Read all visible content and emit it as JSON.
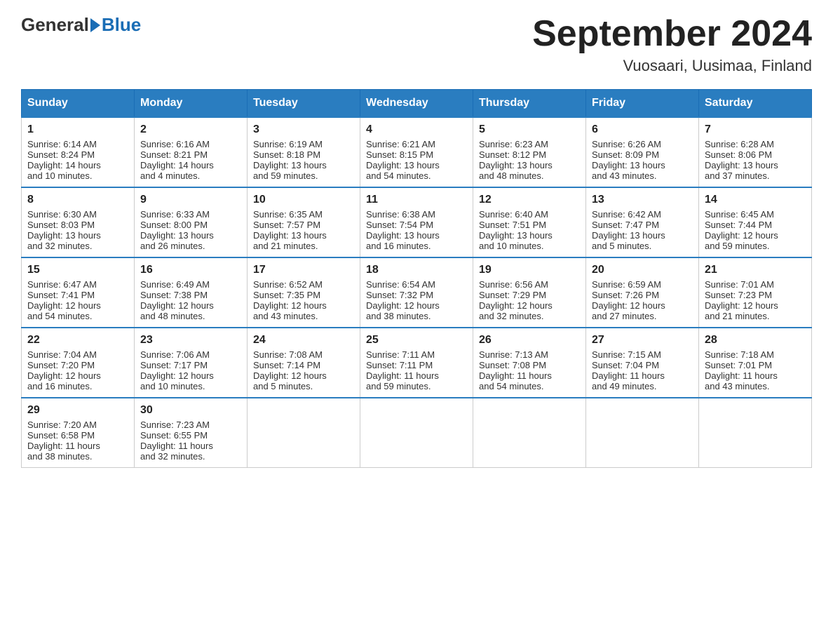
{
  "header": {
    "logo_general": "General",
    "logo_blue": "Blue",
    "month_title": "September 2024",
    "subtitle": "Vuosaari, Uusimaa, Finland"
  },
  "days_of_week": [
    "Sunday",
    "Monday",
    "Tuesday",
    "Wednesday",
    "Thursday",
    "Friday",
    "Saturday"
  ],
  "weeks": [
    [
      {
        "num": "1",
        "sunrise": "6:14 AM",
        "sunset": "8:24 PM",
        "daylight": "14 hours and 10 minutes."
      },
      {
        "num": "2",
        "sunrise": "6:16 AM",
        "sunset": "8:21 PM",
        "daylight": "14 hours and 4 minutes."
      },
      {
        "num": "3",
        "sunrise": "6:19 AM",
        "sunset": "8:18 PM",
        "daylight": "13 hours and 59 minutes."
      },
      {
        "num": "4",
        "sunrise": "6:21 AM",
        "sunset": "8:15 PM",
        "daylight": "13 hours and 54 minutes."
      },
      {
        "num": "5",
        "sunrise": "6:23 AM",
        "sunset": "8:12 PM",
        "daylight": "13 hours and 48 minutes."
      },
      {
        "num": "6",
        "sunrise": "6:26 AM",
        "sunset": "8:09 PM",
        "daylight": "13 hours and 43 minutes."
      },
      {
        "num": "7",
        "sunrise": "6:28 AM",
        "sunset": "8:06 PM",
        "daylight": "13 hours and 37 minutes."
      }
    ],
    [
      {
        "num": "8",
        "sunrise": "6:30 AM",
        "sunset": "8:03 PM",
        "daylight": "13 hours and 32 minutes."
      },
      {
        "num": "9",
        "sunrise": "6:33 AM",
        "sunset": "8:00 PM",
        "daylight": "13 hours and 26 minutes."
      },
      {
        "num": "10",
        "sunrise": "6:35 AM",
        "sunset": "7:57 PM",
        "daylight": "13 hours and 21 minutes."
      },
      {
        "num": "11",
        "sunrise": "6:38 AM",
        "sunset": "7:54 PM",
        "daylight": "13 hours and 16 minutes."
      },
      {
        "num": "12",
        "sunrise": "6:40 AM",
        "sunset": "7:51 PM",
        "daylight": "13 hours and 10 minutes."
      },
      {
        "num": "13",
        "sunrise": "6:42 AM",
        "sunset": "7:47 PM",
        "daylight": "13 hours and 5 minutes."
      },
      {
        "num": "14",
        "sunrise": "6:45 AM",
        "sunset": "7:44 PM",
        "daylight": "12 hours and 59 minutes."
      }
    ],
    [
      {
        "num": "15",
        "sunrise": "6:47 AM",
        "sunset": "7:41 PM",
        "daylight": "12 hours and 54 minutes."
      },
      {
        "num": "16",
        "sunrise": "6:49 AM",
        "sunset": "7:38 PM",
        "daylight": "12 hours and 48 minutes."
      },
      {
        "num": "17",
        "sunrise": "6:52 AM",
        "sunset": "7:35 PM",
        "daylight": "12 hours and 43 minutes."
      },
      {
        "num": "18",
        "sunrise": "6:54 AM",
        "sunset": "7:32 PM",
        "daylight": "12 hours and 38 minutes."
      },
      {
        "num": "19",
        "sunrise": "6:56 AM",
        "sunset": "7:29 PM",
        "daylight": "12 hours and 32 minutes."
      },
      {
        "num": "20",
        "sunrise": "6:59 AM",
        "sunset": "7:26 PM",
        "daylight": "12 hours and 27 minutes."
      },
      {
        "num": "21",
        "sunrise": "7:01 AM",
        "sunset": "7:23 PM",
        "daylight": "12 hours and 21 minutes."
      }
    ],
    [
      {
        "num": "22",
        "sunrise": "7:04 AM",
        "sunset": "7:20 PM",
        "daylight": "12 hours and 16 minutes."
      },
      {
        "num": "23",
        "sunrise": "7:06 AM",
        "sunset": "7:17 PM",
        "daylight": "12 hours and 10 minutes."
      },
      {
        "num": "24",
        "sunrise": "7:08 AM",
        "sunset": "7:14 PM",
        "daylight": "12 hours and 5 minutes."
      },
      {
        "num": "25",
        "sunrise": "7:11 AM",
        "sunset": "7:11 PM",
        "daylight": "11 hours and 59 minutes."
      },
      {
        "num": "26",
        "sunrise": "7:13 AM",
        "sunset": "7:08 PM",
        "daylight": "11 hours and 54 minutes."
      },
      {
        "num": "27",
        "sunrise": "7:15 AM",
        "sunset": "7:04 PM",
        "daylight": "11 hours and 49 minutes."
      },
      {
        "num": "28",
        "sunrise": "7:18 AM",
        "sunset": "7:01 PM",
        "daylight": "11 hours and 43 minutes."
      }
    ],
    [
      {
        "num": "29",
        "sunrise": "7:20 AM",
        "sunset": "6:58 PM",
        "daylight": "11 hours and 38 minutes."
      },
      {
        "num": "30",
        "sunrise": "7:23 AM",
        "sunset": "6:55 PM",
        "daylight": "11 hours and 32 minutes."
      },
      null,
      null,
      null,
      null,
      null
    ]
  ],
  "labels": {
    "sunrise": "Sunrise: ",
    "sunset": "Sunset: ",
    "daylight": "Daylight: "
  }
}
